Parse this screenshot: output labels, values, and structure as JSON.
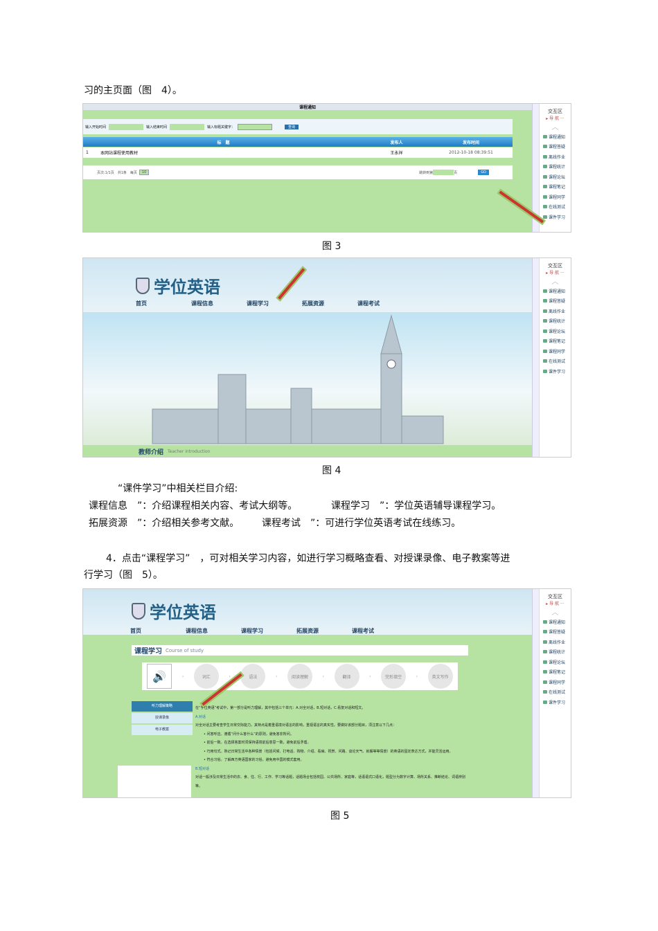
{
  "intro_line": "习的主页面（图　4）。",
  "fig3": {
    "caption": "图 3",
    "dialog_title": "课程通知",
    "filter_start": "输入开始时间",
    "filter_end": "输入结束时间",
    "filter_keyword": "输入标题关键字：",
    "search_button": "查询",
    "col_title": "标　题",
    "col_publisher": "发布人",
    "col_time": "发布时间",
    "row_index": "1",
    "row_title": "本网站课程使用教材",
    "row_publisher": "王永祥",
    "row_time": "2012-10-18 08:39:51",
    "pager_text": "页次:1/1页　共1条　每页",
    "page_size": "10",
    "goto_text": "跳转到第",
    "goto_unit": "页",
    "go_button": "GO"
  },
  "sidebar": {
    "title": "交互区",
    "subtitle": "▸ 导 航 ···",
    "items": [
      "课程通知",
      "课程答疑",
      "离线作业",
      "课程统计",
      "课程论坛",
      "课程笔记",
      "课程同学",
      "在线测试",
      "课件学习"
    ]
  },
  "site": {
    "name": "学位英语",
    "nav": [
      "首页",
      "课程信息",
      "课程学习",
      "拓展资源",
      "课程考试"
    ]
  },
  "fig4": {
    "caption": "图 4",
    "footer_cn": "教师介绍",
    "footer_en": "Teacher introduction"
  },
  "explain": {
    "heading": "“课件学习”中相关栏目介绍:",
    "items": [
      "课程信息　”：介绍课程相关内容、考试大纲等。",
      "课程学习　”：学位英语辅导课程学习。",
      "拓展资源　”：介绍相关参考文献。",
      "课程考试　”：可进行学位英语考试在线练习。"
    ]
  },
  "step4": {
    "line1": "4．点击“课程学习”　，可对相关学习内容，如进行学习概略查看、对授课录像、电子教案等进",
    "line2": "行学习（图　5）。"
  },
  "fig5": {
    "caption": "图 5",
    "section_cn": "课程学习",
    "section_en": "Course of study",
    "steps": [
      "词汇",
      "语法",
      "阅读理解",
      "翻译",
      "完形填空",
      "英文写作"
    ],
    "left_menu": [
      "听力理解策略",
      "授课录像",
      "电子教案"
    ],
    "content": [
      "在“学位英语”考试中，第一部分是听力理解，其中包括三个单元：A.对全对话，B.短对话，C.看复对话和短文。",
      "A.对话",
      "对全对话主要考查学生日常交际能力。其特点是着重语境对语言的影响，重视语言的真实性。要做好该部分题目，须注意以下几点：",
      "• 问答呼应。遵循“问什么答什么”的原则，避免答非所问。",
      "• 前后一致。在选择答案时须保持语境前后意思一致，避免前后矛盾。",
      "• 巧用句式。熟记日常生活中各种情景（包括问候、打电话、购物、介绍、看病、祝贺、问路、谈论天气、就餐等等情景）的英语的固定表达方式，并能灵活运用。",
      "• 符合习俗。了解西方英语国家的习俗，避免用中国的模式套用。",
      "B.短对话",
      "对话一般涉及日常生活中的衣、食、住、行、工作、学习等话题，话题场合包括校园、公共场所、家庭等，话语语式口语化，题型分为数字计算、场所关系、推断结论、词语辨别等。"
    ]
  }
}
